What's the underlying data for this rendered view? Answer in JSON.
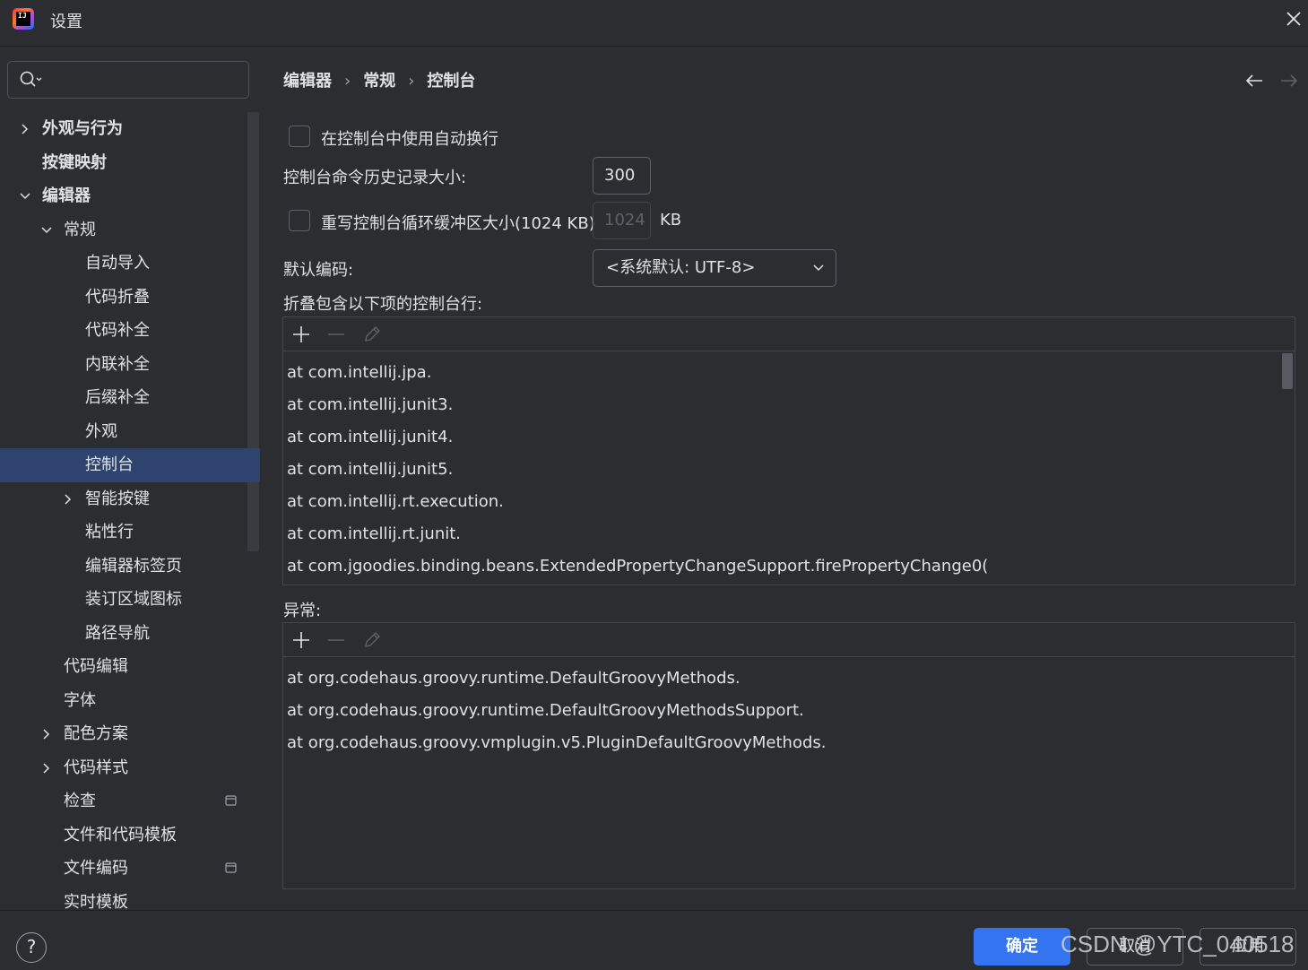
{
  "window": {
    "title": "设置",
    "logo_text": "IJ"
  },
  "sidebar": {
    "search_placeholder": "",
    "items": [
      {
        "label": "外观与行为",
        "level": 0,
        "chevron": "right",
        "bold": true
      },
      {
        "label": "按键映射",
        "level": 0,
        "chevron": "none",
        "bold": true
      },
      {
        "label": "编辑器",
        "level": 0,
        "chevron": "down",
        "bold": true
      },
      {
        "label": "常规",
        "level": 1,
        "chevron": "down"
      },
      {
        "label": "自动导入",
        "level": 2,
        "chevron": "none"
      },
      {
        "label": "代码折叠",
        "level": 2,
        "chevron": "none"
      },
      {
        "label": "代码补全",
        "level": 2,
        "chevron": "none"
      },
      {
        "label": "内联补全",
        "level": 2,
        "chevron": "none"
      },
      {
        "label": "后缀补全",
        "level": 2,
        "chevron": "none"
      },
      {
        "label": "外观",
        "level": 2,
        "chevron": "none"
      },
      {
        "label": "控制台",
        "level": 2,
        "chevron": "none",
        "selected": true
      },
      {
        "label": "智能按键",
        "level": 2,
        "chevron": "right"
      },
      {
        "label": "粘性行",
        "level": 2,
        "chevron": "none"
      },
      {
        "label": "编辑器标签页",
        "level": 2,
        "chevron": "none"
      },
      {
        "label": "装订区域图标",
        "level": 2,
        "chevron": "none"
      },
      {
        "label": "路径导航",
        "level": 2,
        "chevron": "none"
      },
      {
        "label": "代码编辑",
        "level": 1,
        "chevron": "none"
      },
      {
        "label": "字体",
        "level": 1,
        "chevron": "none"
      },
      {
        "label": "配色方案",
        "level": 1,
        "chevron": "right"
      },
      {
        "label": "代码样式",
        "level": 1,
        "chevron": "right"
      },
      {
        "label": "检查",
        "level": 1,
        "chevron": "none",
        "badge": "project-icon"
      },
      {
        "label": "文件和代码模板",
        "level": 1,
        "chevron": "none"
      },
      {
        "label": "文件编码",
        "level": 1,
        "chevron": "none",
        "badge": "project-icon"
      },
      {
        "label": "实时模板",
        "level": 1,
        "chevron": "none"
      }
    ]
  },
  "breadcrumb": [
    "编辑器",
    "常规",
    "控制台"
  ],
  "breadcrumb_separator": "›",
  "settings": {
    "soft_wrap_label": "在控制台中使用自动换行",
    "soft_wrap_checked": false,
    "history_label": "控制台命令历史记录大小:",
    "history_value": "300",
    "override_label": "重写控制台循环缓冲区大小(1024 KB)",
    "override_checked": false,
    "override_value": "1024",
    "override_unit": "KB",
    "encoding_label": "默认编码:",
    "encoding_value": "<系统默认: UTF-8>",
    "fold_label": "折叠包含以下项的控制台行:",
    "fold_lines": [
      "at com.intellij.jpa.",
      "at com.intellij.junit3.",
      "at com.intellij.junit4.",
      "at com.intellij.junit5.",
      "at com.intellij.rt.execution.",
      "at com.intellij.rt.junit.",
      "at com.jgoodies.binding.beans.ExtendedPropertyChangeSupport.firePropertyChange0("
    ],
    "exceptions_label": "异常:",
    "exception_lines": [
      "at org.codehaus.groovy.runtime.DefaultGroovyMethods.",
      "at org.codehaus.groovy.runtime.DefaultGroovyMethodsSupport.",
      "at org.codehaus.groovy.vmplugin.v5.PluginDefaultGroovyMethods."
    ]
  },
  "footer": {
    "help": "?",
    "ok_label": "确定",
    "cancel_label": "取消",
    "apply_label": "应用"
  },
  "watermark": "CSDN @YTC_040518",
  "colors": {
    "background": "#2b2d30",
    "selection": "#2e436e",
    "primary_button": "#3574f0",
    "text": "#dfe1e5",
    "muted": "#5f6166"
  }
}
